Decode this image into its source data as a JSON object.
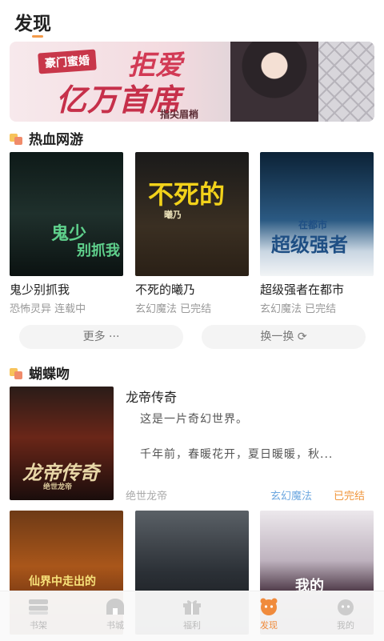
{
  "header": {
    "title": "发现"
  },
  "banner": {
    "tag": "豪门蜜婚",
    "title_line1": "拒爱",
    "title_line2": "亿万首席",
    "author": "指尖眉梢"
  },
  "section1": {
    "title": "热血网游",
    "books": [
      {
        "name": "鬼少别抓我",
        "meta": "恐怖灵异 连载中",
        "cover_text": "鬼少",
        "cover_text2": "别抓我"
      },
      {
        "name": "不死的曦乃",
        "meta": "玄幻魔法 已完结",
        "cover_text": "不死的",
        "cover_sub": "曦乃"
      },
      {
        "name": "超级强者在都市",
        "meta": "玄幻魔法 已完结",
        "cover_text": "超级强者",
        "cover_sub": "在都市"
      }
    ],
    "more_label": "更多 ···",
    "refresh_label": "换一换 ⟳"
  },
  "section2": {
    "title": "蝴蝶吻",
    "feature": {
      "title": "龙帝传奇",
      "desc_line1": "这是一片奇幻世界。",
      "desc_line2": "千年前，春暖花开，夏日暖暖，秋...",
      "author": "绝世龙帝",
      "category": "玄幻魔法",
      "status": "已完结",
      "cover_text": "龙帝传奇",
      "cover_sub": "绝世龙帝"
    },
    "covers": [
      {
        "text": "仙界中走出的"
      },
      {
        "text": ""
      },
      {
        "text": "我的"
      }
    ]
  },
  "tabbar": {
    "items": [
      {
        "label": "书架",
        "icon": "bookshelf-icon"
      },
      {
        "label": "书城",
        "icon": "bookstore-icon"
      },
      {
        "label": "福利",
        "icon": "gift-icon"
      },
      {
        "label": "发现",
        "icon": "discover-icon",
        "active": true
      },
      {
        "label": "我的",
        "icon": "profile-icon"
      }
    ]
  },
  "colors": {
    "accent": "#f08b3c",
    "category_blue": "#6ea8e0",
    "status_orange": "#f0963c"
  }
}
